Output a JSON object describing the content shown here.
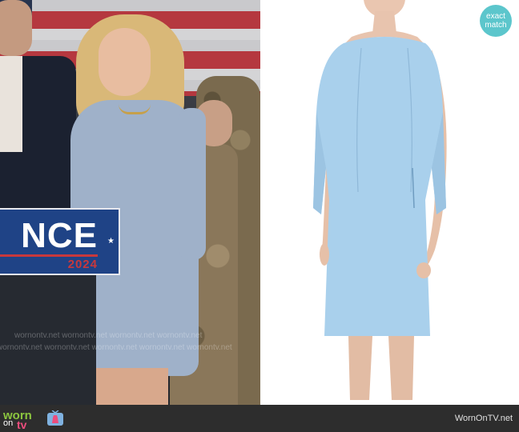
{
  "still": {
    "sign_word": "NCE",
    "sign_year": "2024",
    "watermark_rows": [
      "wornontv.net  wornontv.net  wornontv.net  wornontv.net",
      "wornontv.net  wornontv.net  wornontv.net  wornontv.net  wornontv.net"
    ]
  },
  "product": {
    "badge_line1": "exact",
    "badge_line2": "match",
    "dress_color": "#a9d0ec"
  },
  "footer": {
    "logo_word_worn": "worn",
    "logo_word_on": "on",
    "logo_word_tv": "tv",
    "site_text": "WornOnTV.net"
  }
}
